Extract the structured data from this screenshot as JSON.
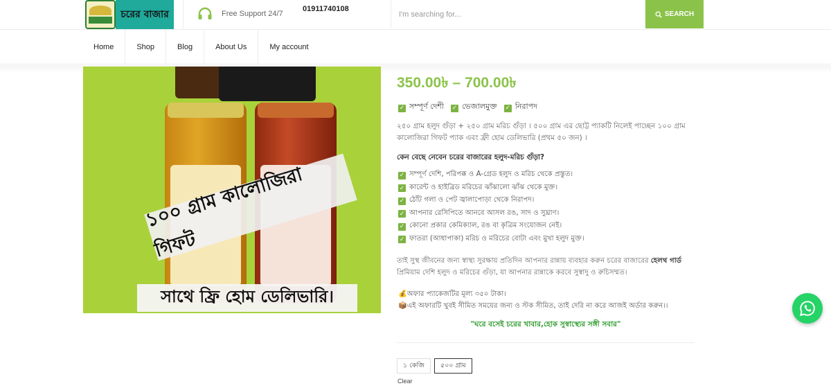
{
  "header": {
    "logo_text": "চরের বাজার",
    "support_label": "Free Support 24/7",
    "phone": "01911740108",
    "search_placeholder": "I'm searching for...",
    "search_button": "SEARCH",
    "accent_color": "#8bc34a"
  },
  "nav": {
    "items": [
      {
        "label": "Home"
      },
      {
        "label": "Shop"
      },
      {
        "label": "Blog"
      },
      {
        "label": "About Us"
      },
      {
        "label": "My account"
      }
    ]
  },
  "product_image": {
    "banner_text": "১০০ গ্রাম কালোজিরা গিফট",
    "bottom_text": "সাথে ফ্রি হোম ডেলিভারি।"
  },
  "product": {
    "price_range": "350.00৳  – 700.00৳",
    "badges": [
      "সম্পূর্ণ দেশী",
      "ভেজালমুক্ত",
      "নিরাপদ"
    ],
    "description": "২৫০ গ্রাম হলুদ গুঁড়া + ২৫০ গ্রাম মরিচ গুঁড়া । ৫০০ গ্রাম এর ছোট্ট প্যাকটি নিলেই পাচ্ছেন ১০০ গ্রাম কালোজিরা গিফট প্যাক এবং ফ্রী হোম ডেলিভারি (প্রথম ৫০ জন) ।",
    "why_heading": "কেন বেছে নেবেন চরের বাজারের হলুদ-মরিচ গুঁড়া?",
    "features": [
      "সম্পূর্ণ দেশি, পরিপক্ক ও A-গ্রেড হলুদ ও মরিচ থেকে প্রস্তুত।",
      "কারেন্ট ও হাইব্রিড মরিচের ঝাঁঝালো ঝাঁঝ থেকে মুক্ত।",
      "ঠোঁট গলা ও পেট জ্বালাপোড়া থেকে নিরাপদ।",
      "আপনার রেসিপিতে আনবে আসল রঙ, সাদ ও সুঘ্রাণ।",
      "কোনো প্রকার কেমিক্যাল, রঙ বা কৃত্রিম সংযোজন নেই।",
      "ফাতরা (আধাপাকা) মরিচ ও মরিচের বোটা এবং মুখা হলুদ মুক্ত।"
    ],
    "para_before": "তাই সুস্থ জীবনের জন্য স্বাস্থ্য সুরক্ষায় প্রতিদিন আপনার রান্নায় ব্যবহার করুন চরের বাজারের ",
    "para_brand": "হেলথ গার্ড",
    "para_after": " প্রিমিয়াম দেশি হলুদ ও মরিচের গুঁড়া, যা আপনার রান্নাকে করবে সুস্বাদু ও রুচিসম্মত।",
    "offer_price": "অফার প্যাকেজটির মূল্য ৩৫০ টাকা।",
    "offer_limited": "এই অফারটি খুবই সীমিত সময়ের জন্য ও স্টক সীমিত, তাই দেরি না করে আজই অর্ডার করুন।।",
    "slogan": "\"ঘরে বসেই চরের খাবার,হোক সুস্বাস্থ্যের সঙ্গী সবার\"",
    "variants": [
      {
        "label": "১ কেজি",
        "selected": false
      },
      {
        "label": "৫০০ গ্রাম",
        "selected": true
      }
    ],
    "clear_label": "Clear"
  },
  "whatsapp": {
    "icon": "whatsapp-icon",
    "color": "#25d366"
  }
}
